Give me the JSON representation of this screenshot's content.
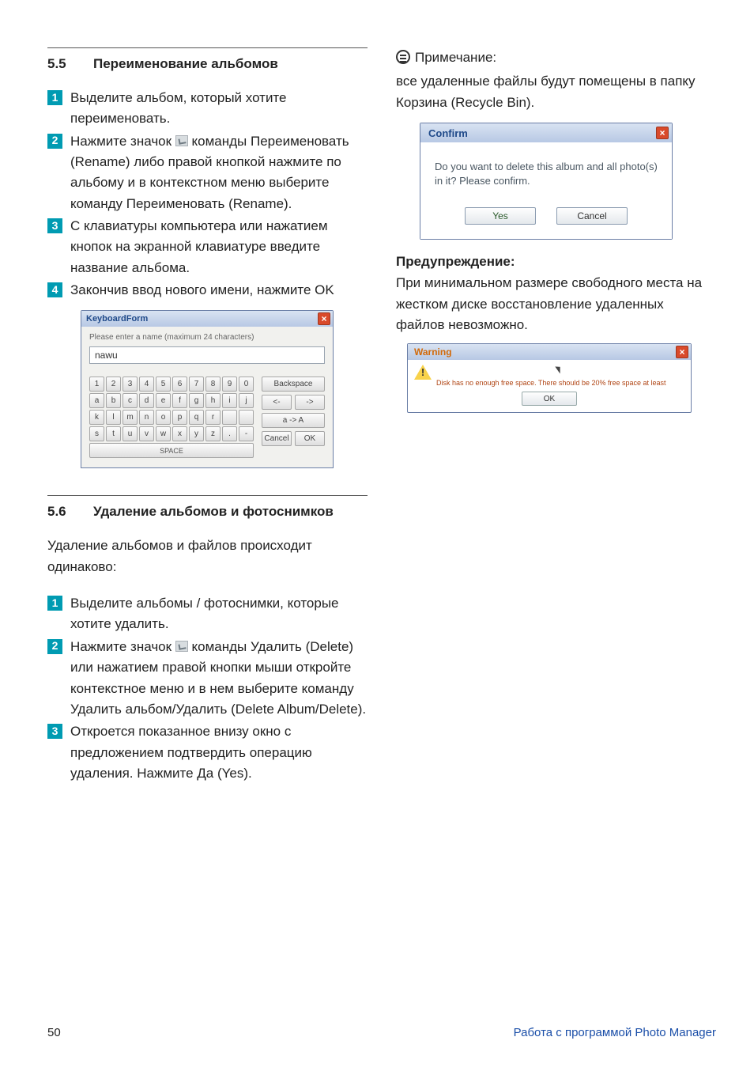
{
  "left": {
    "section55": {
      "num": "5.5",
      "title": "Переименование альбомов",
      "steps": [
        "Выделите альбом, который хотите переименовать.",
        "Нажмите значок [ICON] команды Переименовать (Rename) либо правой кнопкой нажмите по альбому и в контекстном меню выберите команду Переименовать (Rename).",
        "С клавиатуры компьютера или нажатием кнопок на экранной клавиатуре введите название альбома.",
        "Закончив ввод нового имени, нажмите OK"
      ]
    },
    "keyboard": {
      "title": "KeyboardForm",
      "prompt": "Please enter a name (maximum 24 characters)",
      "value": "nawu",
      "rows": [
        [
          "1",
          "2",
          "3",
          "4",
          "5",
          "6",
          "7",
          "8",
          "9",
          "0"
        ],
        [
          "a",
          "b",
          "c",
          "d",
          "e",
          "f",
          "g",
          "h",
          "i",
          "j"
        ],
        [
          "k",
          "l",
          "m",
          "n",
          "o",
          "p",
          "q",
          "r",
          " ",
          " "
        ],
        [
          "s",
          "t",
          "u",
          "v",
          "w",
          "x",
          "y",
          "z",
          ".",
          "-"
        ]
      ],
      "space": "SPACE",
      "backspace": "Backspace",
      "left": "<-",
      "right": "->",
      "case": "a -> A",
      "cancel": "Cancel",
      "ok": "OK"
    },
    "section56": {
      "num": "5.6",
      "title": "Удаление альбомов и фотоснимков",
      "intro": "Удаление альбомов и файлов происходит одинаково:",
      "steps": [
        "Выделите альбомы / фотоснимки, которые хотите удалить.",
        "Нажмите значок [ICON] команды Удалить (Delete) или нажатием правой кнопки мыши откройте контекстное меню и в нем выберите команду Удалить альбом/Удалить (Delete Album/Delete).",
        "Откроется показанное внизу окно с предложением подтвердить операцию удаления. Нажмите Да (Yes)."
      ]
    }
  },
  "right": {
    "note_label": "Примечание:",
    "note_body": "все удаленные файлы будут помещены в папку Корзина (Recycle Bin).",
    "confirm": {
      "title": "Confirm",
      "msg": "Do you want to delete this album and all photo(s) in it? Please confirm.",
      "yes": "Yes",
      "cancel": "Cancel"
    },
    "warn_head": "Предупреждение:",
    "warn_body": "При минимальном размере свободного места на жестком диске восстановление удаленных файлов невозможно.",
    "warning": {
      "title": "Warning",
      "msg": "Disk has no enough free space. There should be 20%  free space at least",
      "ok": "OK"
    }
  },
  "footer": {
    "page": "50",
    "right": "Работа с программой Photo Manager"
  }
}
